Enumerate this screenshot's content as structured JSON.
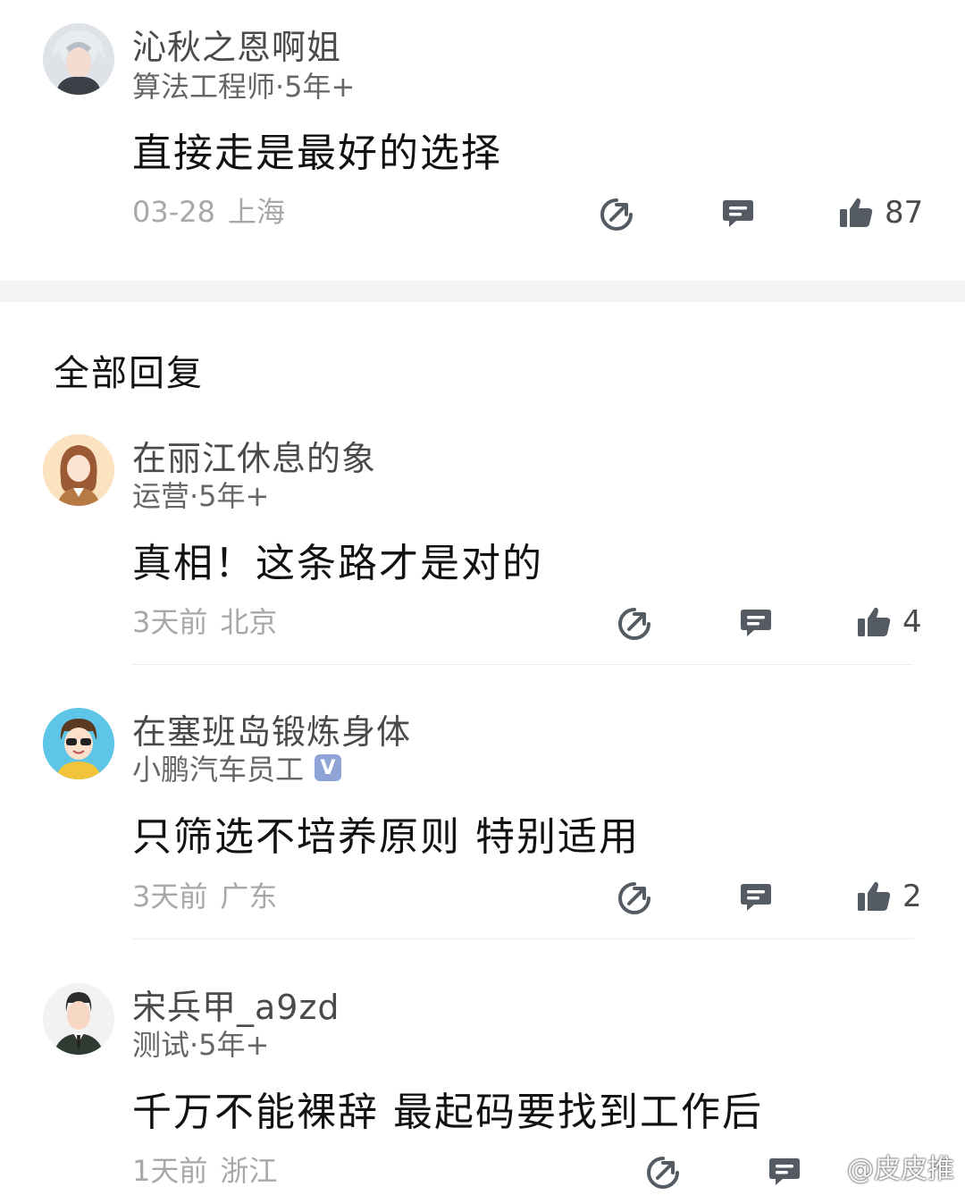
{
  "top_comment": {
    "username": "沁秋之恩啊姐",
    "title": "算法工程师·5年+",
    "content": "直接走是最好的选择",
    "date": "03-28",
    "location": "上海",
    "likes": "87"
  },
  "section": {
    "title": "全部回复"
  },
  "replies": [
    {
      "username": "在丽江休息的象",
      "title": "运营·5年+",
      "content": "真相！这条路才是对的",
      "date": "3天前",
      "location": "北京",
      "likes": "4"
    },
    {
      "username": "在塞班岛锻炼身体",
      "title": "小鹏汽车员工",
      "badge": "V",
      "content": "只筛选不培养原则  特别适用",
      "date": "3天前",
      "location": "广东",
      "likes": "2"
    },
    {
      "username": "宋兵甲_a9zd",
      "title": "测试·5年+",
      "content": "千万不能裸辞  最起码要找到工作后",
      "date": "1天前",
      "location": "浙江"
    }
  ],
  "watermark": {
    "text": "@皮皮推"
  },
  "icons": {
    "share": "share-icon",
    "comment": "comment-icon",
    "like": "thumbs-up-icon"
  },
  "colors": {
    "icon": "#555b63",
    "meta": "#a8a8a8",
    "band": "#f3f4f6"
  }
}
